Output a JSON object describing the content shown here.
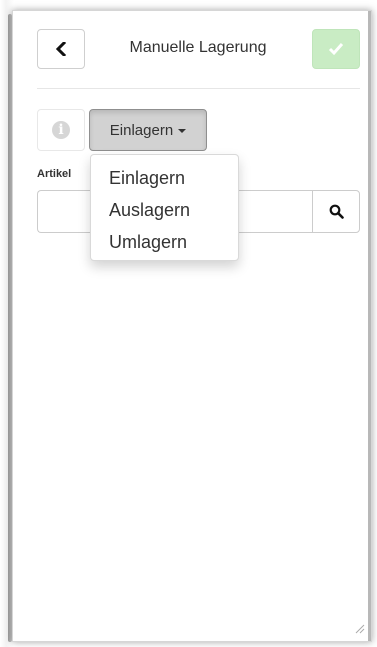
{
  "header": {
    "title": "Manuelle Lagerung"
  },
  "icons": {
    "back": "chevron-left-icon",
    "confirm": "check-icon",
    "info": "info-icon",
    "search": "search-icon",
    "resize": "resize-grip-icon"
  },
  "colors": {
    "confirm_button": "#c9ecc4",
    "mode_button_active": "#d2d2d2",
    "info_icon": "#d6d6d6"
  },
  "mode": {
    "selected": "Einlagern",
    "options": [
      "Einlagern",
      "Auslagern",
      "Umlagern"
    ]
  },
  "form": {
    "artikel_label": "Artikel",
    "artikel_value": ""
  }
}
